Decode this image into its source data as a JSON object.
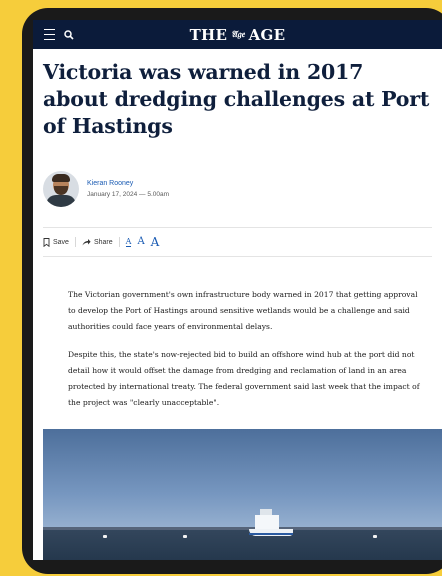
{
  "masthead": {
    "left": "THE",
    "crest": "𝔄𝔤𝔢",
    "right": "AGE"
  },
  "article": {
    "headline": "Victoria was warned in 2017 about dredging challenges at Port of Hastings",
    "author": "Kieran Rooney",
    "date": "January 17, 2024 — 5.00am",
    "paragraphs": [
      "The Victorian government's own infrastructure body warned in 2017 that getting approval to develop the Port of Hastings around sensitive wetlands would be a challenge and said authorities could face years of environmental delays.",
      "Despite this, the state's now-rejected bid to build an offshore wind hub at the port did not detail how it would offset the damage from dredging and reclamation of land in an area protected by international treaty. The federal government said last week that the impact of the project was \"clearly unacceptable\"."
    ]
  },
  "toolbar": {
    "save_label": "Save",
    "share_label": "Share",
    "font_small": "A",
    "font_medium": "A",
    "font_large": "A"
  },
  "colors": {
    "frame_bg": "#f6cd3b",
    "nav_bg": "#0b1b3a",
    "accent": "#1a5bb3",
    "headline": "#0f1f3c"
  },
  "icons": [
    "hamburger-menu-icon",
    "search-icon",
    "bookmark-icon",
    "share-arrow-icon"
  ]
}
